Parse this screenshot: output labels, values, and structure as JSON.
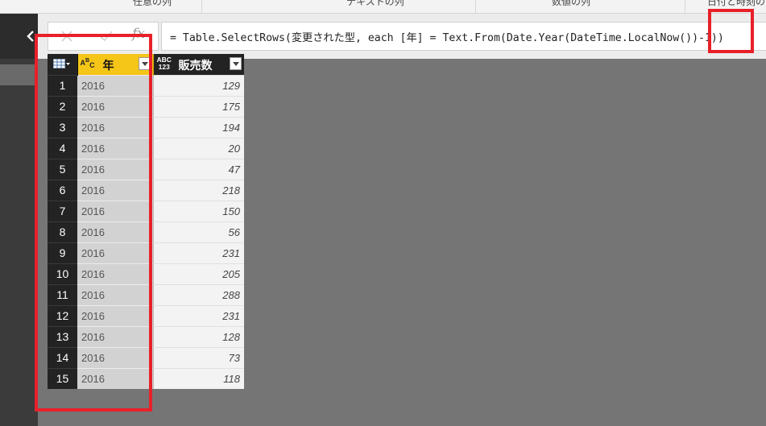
{
  "ribbon": {
    "items": [
      "任意の列",
      "テキストの列",
      "数値の列",
      "日付と時刻の"
    ]
  },
  "formula_bar": {
    "cancel_icon": "x-icon",
    "commit_icon": "check-icon",
    "fx_label": "fx",
    "formula": "= Table.SelectRows(変更された型, each [年] = Text.From(Date.Year(DateTime.LocalNow())-1))"
  },
  "grid": {
    "columns": [
      {
        "name": "年",
        "type_icon": "ABC"
      },
      {
        "name": "販売数",
        "type_icon": "ABC 123"
      }
    ],
    "rows": [
      {
        "n": "1",
        "year": "2016",
        "sales": "129"
      },
      {
        "n": "2",
        "year": "2016",
        "sales": "175"
      },
      {
        "n": "3",
        "year": "2016",
        "sales": "194"
      },
      {
        "n": "4",
        "year": "2016",
        "sales": "20"
      },
      {
        "n": "5",
        "year": "2016",
        "sales": "47"
      },
      {
        "n": "6",
        "year": "2016",
        "sales": "218"
      },
      {
        "n": "7",
        "year": "2016",
        "sales": "150"
      },
      {
        "n": "8",
        "year": "2016",
        "sales": "56"
      },
      {
        "n": "9",
        "year": "2016",
        "sales": "231"
      },
      {
        "n": "10",
        "year": "2016",
        "sales": "205"
      },
      {
        "n": "11",
        "year": "2016",
        "sales": "288"
      },
      {
        "n": "12",
        "year": "2016",
        "sales": "231"
      },
      {
        "n": "13",
        "year": "2016",
        "sales": "128"
      },
      {
        "n": "14",
        "year": "2016",
        "sales": "73"
      },
      {
        "n": "15",
        "year": "2016",
        "sales": "118"
      }
    ]
  },
  "colors": {
    "accent_yellow": "#f5c518",
    "annotation_red": "#e8202a",
    "workspace_gray": "#757575"
  }
}
